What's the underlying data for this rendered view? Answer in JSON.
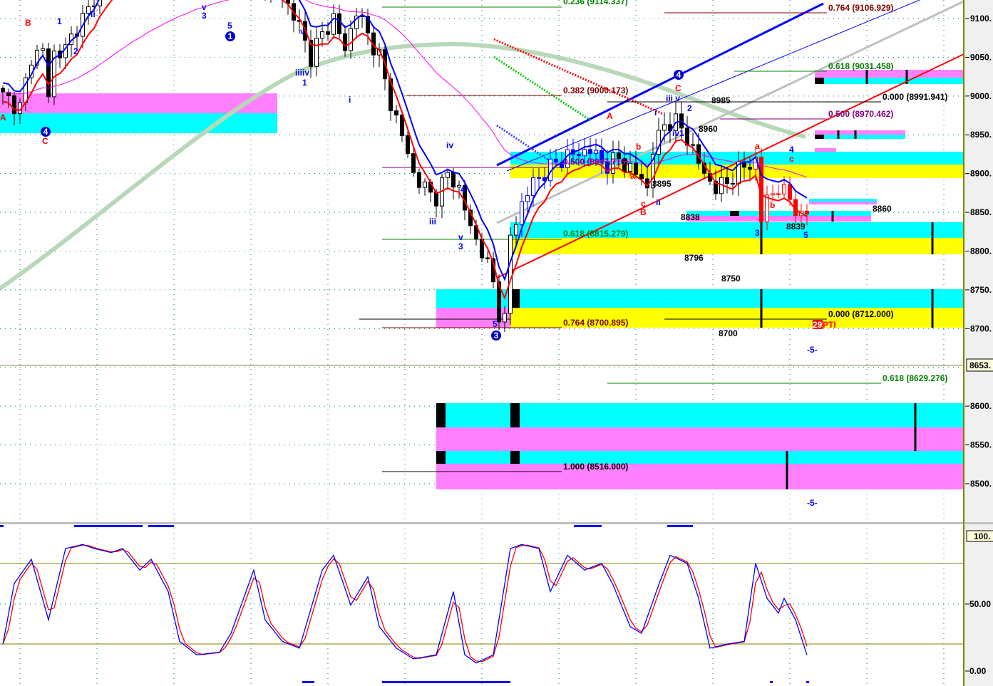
{
  "chart_data": [
    {
      "type": "candlestick",
      "title": "",
      "y_axis": {
        "ticks": [
          "9100.",
          "9050.",
          "9000.",
          "8950.",
          "8900.",
          "8850.",
          "8800.",
          "8750.",
          "8700.",
          "8600.",
          "8550.",
          "8500."
        ],
        "ylim": [
          8450,
          9125
        ],
        "current_price_label": "8653."
      },
      "price_path_approx": [
        [
          0,
          9000
        ],
        [
          3,
          8985
        ],
        [
          5,
          9050
        ],
        [
          7,
          9060
        ],
        [
          8,
          9000
        ],
        [
          9,
          9055
        ],
        [
          11,
          9060
        ],
        [
          13,
          9090
        ],
        [
          15,
          9110
        ],
        [
          17,
          9140
        ],
        [
          20,
          9160
        ],
        [
          30,
          9170
        ],
        [
          40,
          9160
        ],
        [
          49,
          9130
        ],
        [
          52,
          9090
        ],
        [
          54,
          9050
        ],
        [
          56,
          9080
        ],
        [
          58,
          9100
        ],
        [
          60,
          9060
        ],
        [
          62,
          9110
        ],
        [
          64,
          9080
        ],
        [
          66,
          9050
        ],
        [
          68,
          8990
        ],
        [
          70,
          8950
        ],
        [
          72,
          8900
        ],
        [
          74,
          8880
        ],
        [
          76,
          8870
        ],
        [
          78,
          8900
        ],
        [
          80,
          8880
        ],
        [
          82,
          8830
        ],
        [
          84,
          8800
        ],
        [
          86,
          8760
        ],
        [
          87,
          8720
        ],
        [
          88,
          8710
        ],
        [
          89,
          8820
        ],
        [
          91,
          8860
        ],
        [
          93,
          8890
        ],
        [
          95,
          8900
        ],
        [
          97,
          8915
        ],
        [
          100,
          8925
        ],
        [
          103,
          8930
        ],
        [
          106,
          8910
        ],
        [
          108,
          8920
        ],
        [
          110,
          8905
        ],
        [
          112,
          8895
        ],
        [
          113,
          8880
        ],
        [
          114,
          8930
        ],
        [
          116,
          8965
        ],
        [
          118,
          8965
        ],
        [
          119,
          8960
        ],
        [
          121,
          8930
        ],
        [
          123,
          8900
        ],
        [
          125,
          8880
        ],
        [
          127,
          8890
        ],
        [
          130,
          8910
        ],
        [
          132,
          8915
        ],
        [
          133,
          8840
        ],
        [
          134,
          8870
        ],
        [
          136,
          8880
        ],
        [
          138,
          8870
        ],
        [
          140,
          8840
        ],
        [
          141,
          8850
        ]
      ],
      "fib_labels": [
        "0.236 (9114.337)",
        "0.764 (9106.929)",
        "0.618 (9031.458)",
        "0.382 (9000.173)",
        "0.000 (8991.941)",
        "0.500 (8970.462)",
        "0.500 (8947.716)",
        "0.618 (8815.279)",
        "0.764 (8700.895)",
        "0.000 (8712.000)",
        "0.618 (8629.276)",
        "1.000 (8516.000)"
      ],
      "price_labels": [
        "8985",
        "8960",
        "8895",
        "8838",
        "8860",
        "8796",
        "8750",
        "8700",
        "8839"
      ],
      "wave_labels": {
        "blue": [
          "v",
          "3",
          "5",
          "1",
          "ii",
          "2",
          "v",
          "iii",
          "iv",
          "1",
          "i",
          "iv",
          "4",
          "iii",
          "v",
          "3",
          "5",
          "ii",
          "i",
          "iii v",
          "2",
          "iv1",
          "4",
          "3",
          "5",
          "-5-",
          "-5-"
        ],
        "red": [
          "B",
          "C",
          "A",
          "A",
          "b",
          "a",
          "c",
          "B",
          "C",
          "a",
          "c",
          "b"
        ],
        "circled": [
          "1",
          "4",
          "3",
          "4"
        ]
      },
      "pti": {
        "count": "29",
        "label": "PTI"
      }
    },
    {
      "type": "line",
      "title": "Stochastic",
      "y_axis": {
        "ticks": [
          "100.",
          "50.00",
          "0.00"
        ],
        "ylim": [
          0,
          100
        ],
        "levels": [
          20,
          80
        ]
      },
      "series_k_approx": [
        [
          0,
          20
        ],
        [
          2,
          65
        ],
        [
          5,
          83
        ],
        [
          8,
          38
        ],
        [
          11,
          91
        ],
        [
          14,
          94
        ],
        [
          16,
          91
        ],
        [
          19,
          88
        ],
        [
          21,
          91
        ],
        [
          24,
          75
        ],
        [
          26,
          83
        ],
        [
          29,
          59
        ],
        [
          31,
          22
        ],
        [
          34,
          12
        ],
        [
          38,
          14
        ],
        [
          40,
          28
        ],
        [
          44,
          75
        ],
        [
          46,
          38
        ],
        [
          49,
          22
        ],
        [
          52,
          17
        ],
        [
          56,
          75
        ],
        [
          58,
          86
        ],
        [
          61,
          49
        ],
        [
          64,
          70
        ],
        [
          66,
          33
        ],
        [
          69,
          17
        ],
        [
          72,
          9
        ],
        [
          76,
          12
        ],
        [
          79,
          59
        ],
        [
          81,
          12
        ],
        [
          83,
          6
        ],
        [
          86,
          12
        ],
        [
          89,
          91
        ],
        [
          91,
          94
        ],
        [
          94,
          91
        ],
        [
          96,
          59
        ],
        [
          99,
          86
        ],
        [
          102,
          75
        ],
        [
          105,
          80
        ],
        [
          107,
          64
        ],
        [
          110,
          33
        ],
        [
          112,
          28
        ],
        [
          115,
          64
        ],
        [
          117,
          86
        ],
        [
          120,
          80
        ],
        [
          122,
          54
        ],
        [
          124,
          17
        ],
        [
          127,
          20
        ],
        [
          130,
          22
        ],
        [
          132,
          80
        ],
        [
          134,
          54
        ],
        [
          136,
          43
        ],
        [
          137,
          54
        ],
        [
          139,
          38
        ],
        [
          141,
          12
        ]
      ]
    }
  ],
  "colors": {
    "cyan": "#00ffff",
    "magenta": "#ff80ff",
    "yellow": "#ffff00",
    "blue": "#0000ff",
    "red": "#ff0000",
    "grid": "#008080",
    "ma_long": "#b8d8b8"
  }
}
